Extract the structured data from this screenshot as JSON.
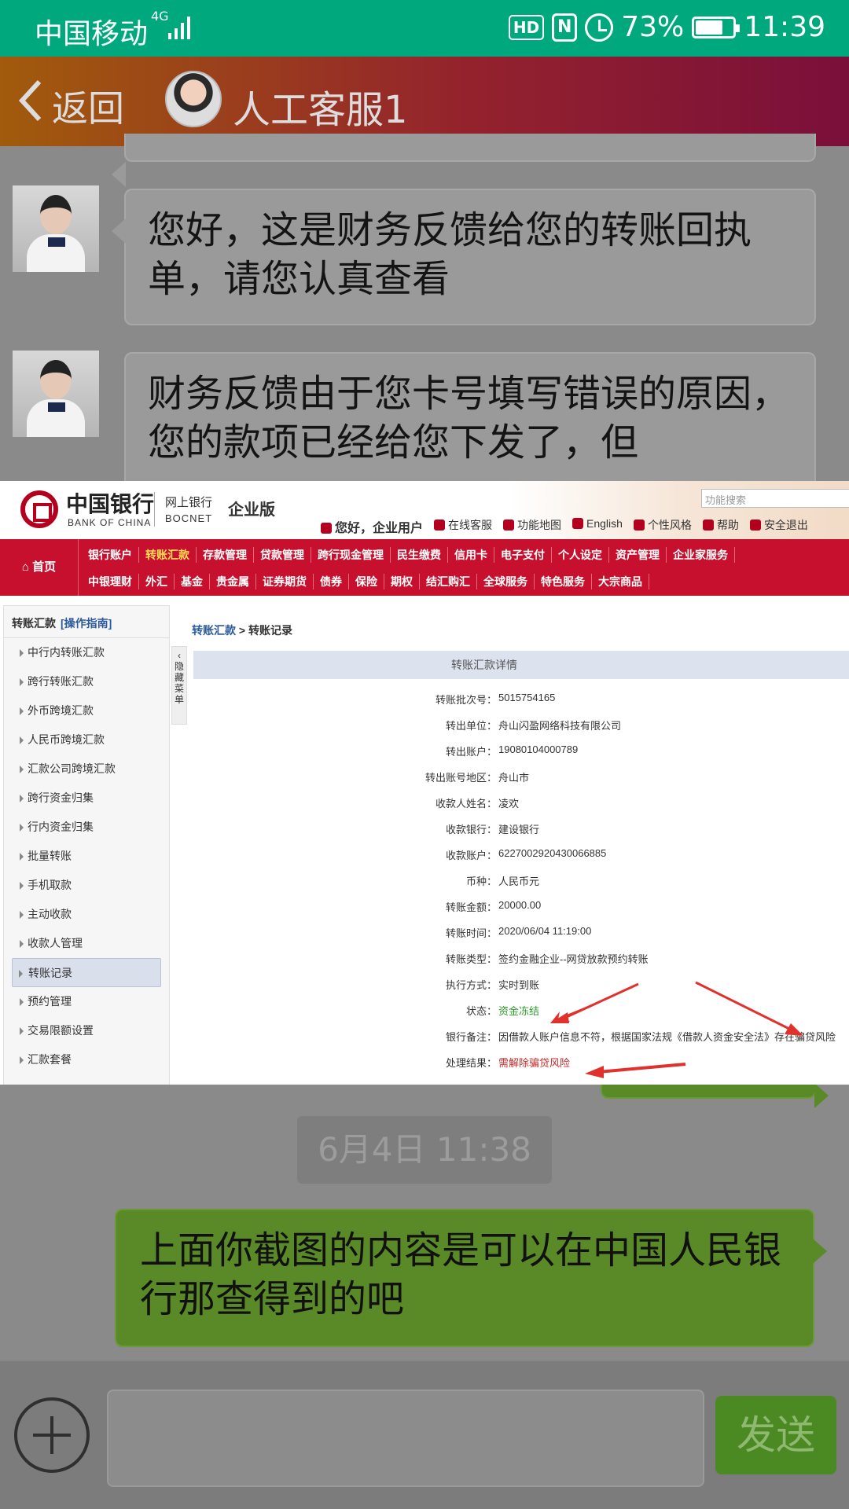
{
  "status_bar": {
    "carrier": "中国移动",
    "network": "4G",
    "battery": "73%",
    "time": "11:39",
    "hd": "HD",
    "nfc": "N"
  },
  "header": {
    "back_label": "返回",
    "title": "人工客服1"
  },
  "messages": [
    {
      "side": "left",
      "text": "您好，这是财务反馈给您的转账回执单，请您认真查看"
    },
    {
      "side": "left",
      "text": "财务反馈由于您卡号填写错误的原因，您的款项已经给您下发了，但"
    },
    {
      "side": "timestamp",
      "text": "6月4日 11:38"
    },
    {
      "side": "right",
      "text": "上面你截图的内容是可以在中国人民银行那查得到的吧"
    }
  ],
  "input_bar": {
    "send_label": "发送"
  },
  "bank": {
    "name_cn": "中国银行",
    "name_en": "BANK OF CHINA",
    "bocnet_cn": "网上银行",
    "bocnet_en": "BOCNET",
    "edition": "企业版",
    "search_placeholder": "功能搜索",
    "greeting": "您好，企业用户",
    "top_links": [
      "在线客服",
      "功能地图",
      "English",
      "个性风格",
      "帮助",
      "安全退出"
    ],
    "home": "首页",
    "nav_row1": [
      "银行账户",
      "转账汇款",
      "存款管理",
      "贷款管理",
      "跨行现金管理",
      "民生缴费",
      "信用卡",
      "电子支付",
      "个人设定",
      "资产管理",
      "企业家服务"
    ],
    "nav_row2": [
      "中银理财",
      "外汇",
      "基金",
      "贵金属",
      "证券期货",
      "债券",
      "保险",
      "期权",
      "结汇购汇",
      "全球服务",
      "特色服务",
      "大宗商品"
    ],
    "nav_active": "转账汇款",
    "sidebar_title": "转账汇款",
    "sidebar_guide": "[操作指南]",
    "sidebar_items": [
      "中行内转账汇款",
      "跨行转账汇款",
      "外币跨境汇款",
      "人民币跨境汇款",
      "汇款公司跨境汇款",
      "跨行资金归集",
      "行内资金归集",
      "批量转账",
      "手机取款",
      "主动收款",
      "收款人管理",
      "转账记录",
      "预约管理",
      "交易限额设置",
      "汇款套餐"
    ],
    "sidebar_active": "转账记录",
    "toggle_label": "隐藏菜单",
    "breadcrumb_link": "转账汇款",
    "breadcrumb_current": "转账记录",
    "detail_title": "转账汇款详情",
    "details": [
      {
        "k": "转账批次号：",
        "v": "5015754165"
      },
      {
        "k": "转出单位：",
        "v": "舟山闪盈网络科技有限公司"
      },
      {
        "k": "转出账户：",
        "v": "19080104000789"
      },
      {
        "k": "转出账号地区：",
        "v": "舟山市"
      },
      {
        "k": "收款人姓名：",
        "v": "凌欢"
      },
      {
        "k": "收款银行：",
        "v": "建设银行"
      },
      {
        "k": "收款账户：",
        "v": "6227002920430066885"
      },
      {
        "k": "币种：",
        "v": "人民币元"
      },
      {
        "k": "转账金额：",
        "v": "20000.00"
      },
      {
        "k": "转账时间：",
        "v": "2020/06/04 11:19:00"
      },
      {
        "k": "转账类型：",
        "v": "签约金融企业--网贷放款预约转账"
      },
      {
        "k": "执行方式：",
        "v": "实时到账"
      },
      {
        "k": "状态：",
        "v": "资金冻结"
      },
      {
        "k": "银行备注：",
        "v": "因借款人账户信息不符，根据国家法规《借款人资金安全法》存在骗贷风险"
      },
      {
        "k": "处理结果：",
        "v": "需解除骗贷风险"
      }
    ],
    "annotation_color": "#e0312d"
  }
}
